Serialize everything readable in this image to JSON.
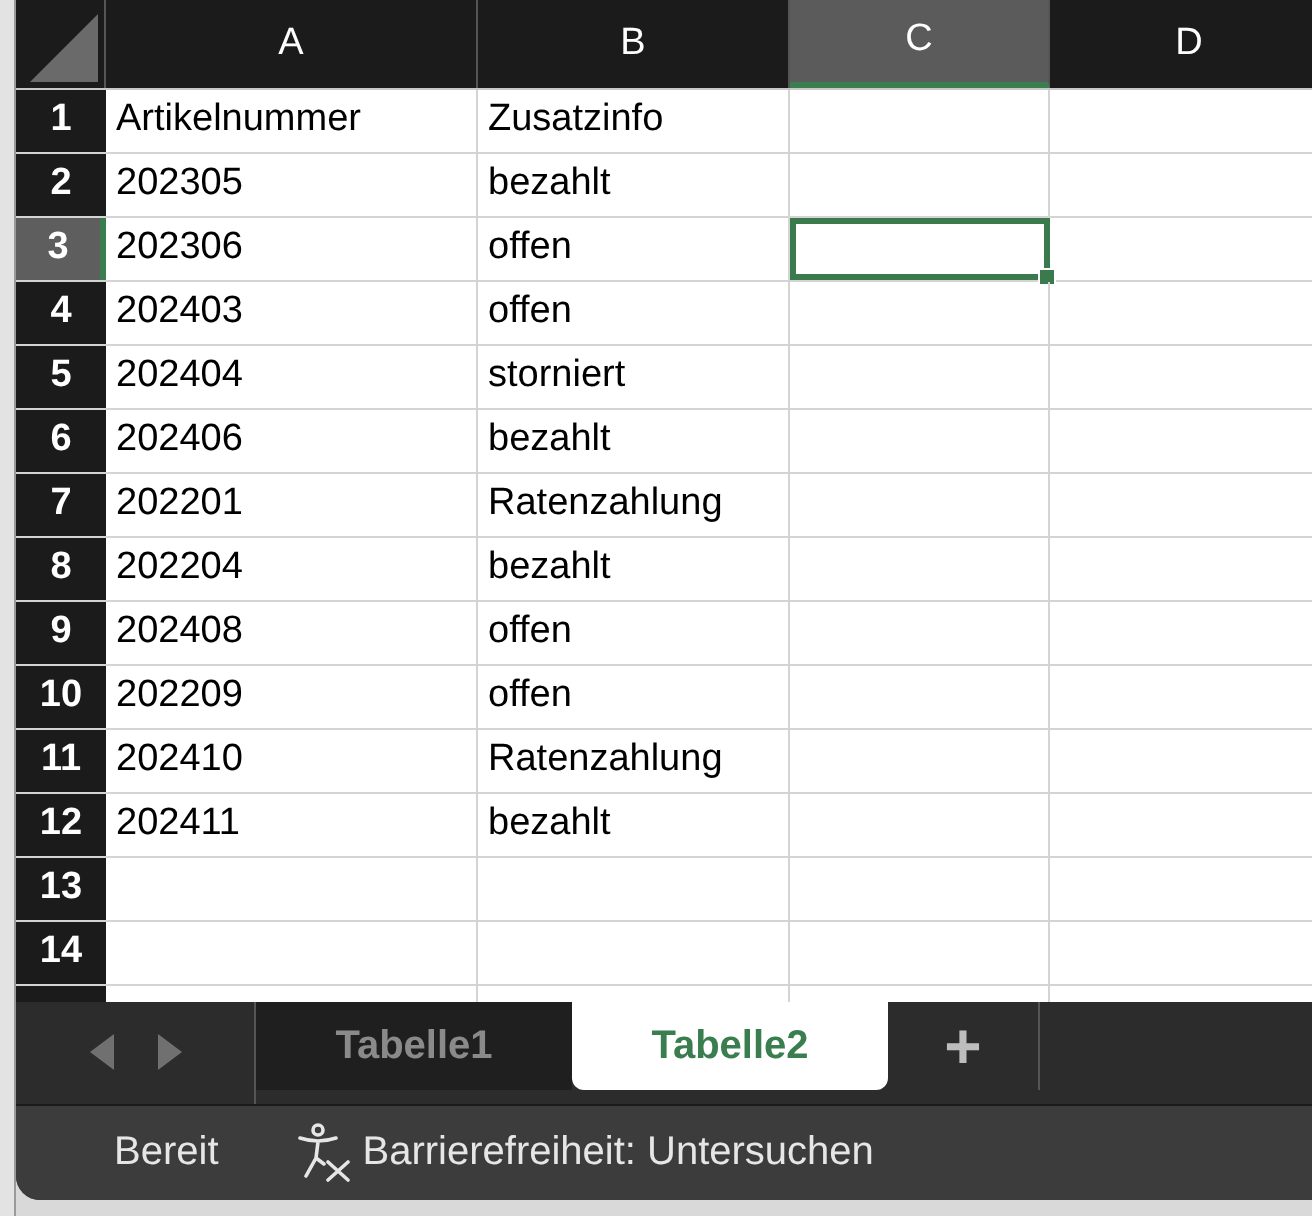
{
  "columns": [
    {
      "label": "A",
      "selected": false
    },
    {
      "label": "B",
      "selected": false
    },
    {
      "label": "C",
      "selected": true
    },
    {
      "label": "D",
      "selected": false
    }
  ],
  "rows": [
    {
      "label": "1",
      "selected": false,
      "cells": [
        "Artikelnummer",
        "Zusatzinfo"
      ]
    },
    {
      "label": "2",
      "selected": false,
      "cells": [
        "202305",
        "bezahlt"
      ]
    },
    {
      "label": "3",
      "selected": true,
      "cells": [
        "202306",
        "offen"
      ]
    },
    {
      "label": "4",
      "selected": false,
      "cells": [
        "202403",
        "offen"
      ]
    },
    {
      "label": "5",
      "selected": false,
      "cells": [
        "202404",
        "storniert"
      ]
    },
    {
      "label": "6",
      "selected": false,
      "cells": [
        "202406",
        "bezahlt"
      ]
    },
    {
      "label": "7",
      "selected": false,
      "cells": [
        "202201",
        "Ratenzahlung"
      ]
    },
    {
      "label": "8",
      "selected": false,
      "cells": [
        "202204",
        "bezahlt"
      ]
    },
    {
      "label": "9",
      "selected": false,
      "cells": [
        "202408",
        "offen"
      ]
    },
    {
      "label": "10",
      "selected": false,
      "cells": [
        "202209",
        "offen"
      ]
    },
    {
      "label": "11",
      "selected": false,
      "cells": [
        "202410",
        "Ratenzahlung"
      ]
    },
    {
      "label": "12",
      "selected": false,
      "cells": [
        "202411",
        "bezahlt"
      ]
    },
    {
      "label": "13",
      "selected": false
    },
    {
      "label": "14",
      "selected": false
    },
    {
      "selected": false
    }
  ],
  "sheet_tabs": [
    {
      "label": "Tabelle1",
      "selected": false
    },
    {
      "label": "Tabelle2",
      "selected": true
    }
  ],
  "add_sheet": "+",
  "status_bar": {
    "status": "Bereit",
    "accessibility": "Barrierefreiheit: Untersuchen"
  }
}
